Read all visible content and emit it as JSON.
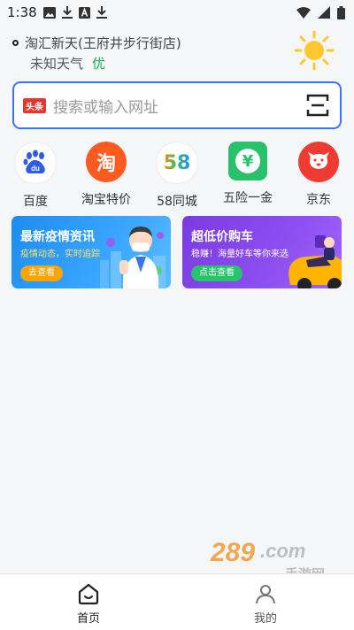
{
  "status_bar": {
    "time": "1:38"
  },
  "location": {
    "name": "淘汇新天(王府井步行街店)"
  },
  "weather": {
    "text": "未知天气",
    "aqi": "优"
  },
  "search": {
    "badge": "头条",
    "placeholder": "搜索或输入网址"
  },
  "shortcuts": [
    {
      "label": "百度",
      "icon": "baidu-icon",
      "glyph": "du"
    },
    {
      "label": "淘宝特价",
      "icon": "taobao-icon",
      "glyph": "淘"
    },
    {
      "label": "58同城",
      "icon": "58-icon",
      "glyph": "58"
    },
    {
      "label": "五险一金",
      "icon": "yen-icon",
      "glyph": "¥"
    },
    {
      "label": "京东",
      "icon": "jd-dog-icon",
      "glyph": ""
    }
  ],
  "banners": [
    {
      "title": "最新疫情资讯",
      "subtitle": "疫情动态，实时追踪",
      "button": "去查看"
    },
    {
      "title": "超低价购车",
      "subtitle": "稳赚！海量好车等你来选",
      "button": "点击查看"
    }
  ],
  "nav": [
    {
      "label": "首页",
      "icon": "home-icon"
    },
    {
      "label": "我的",
      "icon": "user-icon"
    }
  ],
  "watermark": {
    "text": "289.com",
    "subtext": "手游网"
  },
  "colors": {
    "accent": "#3b74f2",
    "aqi_good": "#1fae4b"
  }
}
